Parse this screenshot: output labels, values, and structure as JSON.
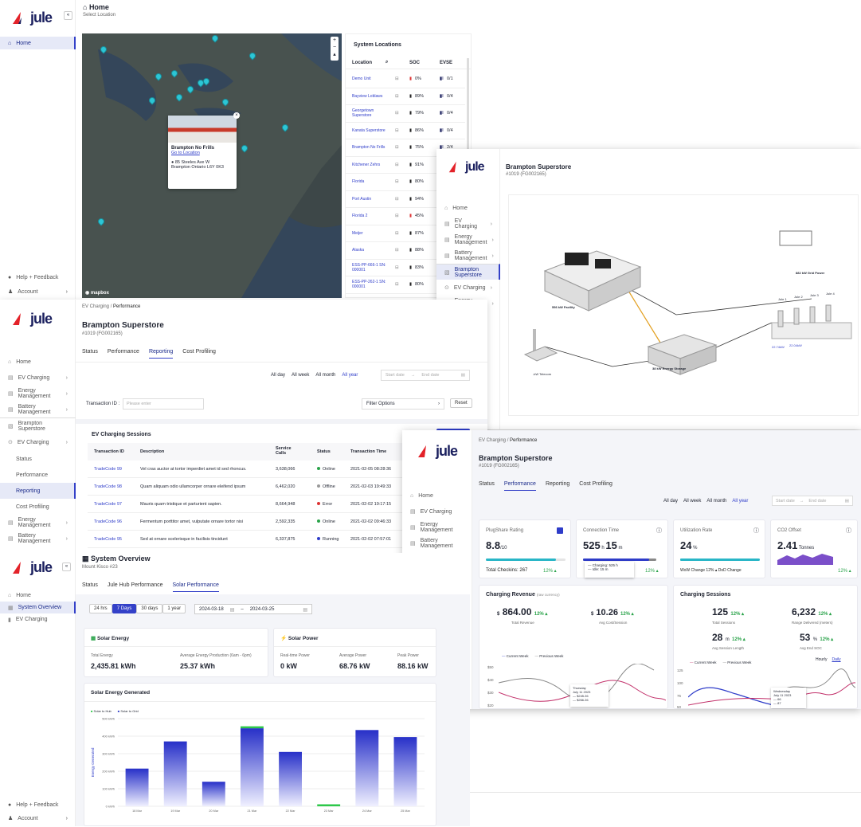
{
  "main": {
    "title": "Home",
    "subtitle": "Select Location",
    "nav": [
      {
        "label": "Home"
      }
    ],
    "footer": {
      "help": "Help + Feedback",
      "account": "Account"
    },
    "map": {
      "attribution": "mapbox",
      "popup": {
        "name": "Brampton No Frills",
        "link": "Go to Location",
        "address1": "85 Steeles Ave W",
        "address2": "Brampton Ontario L6Y 0K3"
      }
    },
    "locations": {
      "title": "System Locations",
      "columns": [
        "Location",
        "SOC",
        "EVSE"
      ],
      "rows": [
        {
          "name": "Demo Unit",
          "soc": "0%",
          "evse": "0/1"
        },
        {
          "name": "Bayview Loblaws",
          "soc": "89%",
          "evse": "0/4"
        },
        {
          "name": "Georgetown Superstore",
          "soc": "79%",
          "evse": "0/4"
        },
        {
          "name": "Kanata Superstore",
          "soc": "86%",
          "evse": "0/4"
        },
        {
          "name": "Brampton No Frills",
          "soc": "75%",
          "evse": "2/4"
        },
        {
          "name": "Kitchener Zehrs",
          "soc": "91%",
          "evse": ""
        },
        {
          "name": "Florida",
          "soc": "80%",
          "evse": ""
        },
        {
          "name": "Port Austin",
          "soc": "94%",
          "evse": ""
        },
        {
          "name": "Florida 2",
          "soc": "45%",
          "evse": ""
        },
        {
          "name": "Meijer",
          "soc": "87%",
          "evse": ""
        },
        {
          "name": "Alaska",
          "soc": "88%",
          "evse": ""
        },
        {
          "name": "ESS-PP-666-1 SN: 000001",
          "soc": "83%",
          "evse": ""
        },
        {
          "name": "ESS-PP-262-1 SN: 000001",
          "soc": "80%",
          "evse": ""
        }
      ]
    }
  },
  "diagram": {
    "site": "Brampton Superstore",
    "site_id": "#1019 (FG002165)",
    "nav": [
      {
        "label": "Home"
      },
      {
        "label": "EV Charging"
      },
      {
        "label": "Energy Management"
      },
      {
        "label": "Battery Management"
      },
      {
        "label": "Brampton Superstore"
      },
      {
        "label": "EV Charging"
      },
      {
        "label": "Energy Management"
      }
    ],
    "labels": {
      "facility": "556 kW Facility",
      "grid": "882 kW Grid Power",
      "telecom": "-kW Telecom",
      "storage": "38 kW Energy Storage",
      "jules": [
        "Jule 1",
        "Jule 2",
        "Jule 3",
        "Jule 4"
      ],
      "status1": "22.74kW",
      "status2": "22.04kW"
    }
  },
  "reporting": {
    "breadcrumb": [
      "EV Charging",
      "Performance"
    ],
    "site": "Brampton Superstore",
    "site_id": "#1019 (FG002165)",
    "tabs": [
      "Status",
      "Performance",
      "Reporting",
      "Cost Profiling"
    ],
    "ranges": [
      "All day",
      "All week",
      "All month",
      "All year"
    ],
    "start_placeholder": "Start date",
    "end_placeholder": "End date",
    "txn_label": "Transaction ID :",
    "txn_placeholder": "Please enter",
    "filter": "Filter Options",
    "reset": "Reset",
    "table_title": "EV Charging Sessions",
    "columns": [
      "Transaction ID",
      "Description",
      "Service Calls",
      "Status",
      "Transaction Time"
    ],
    "rows": [
      {
        "id": "TradeCode 99",
        "desc": "Vel cras auctor at tortor imperdiet amet id sed rhoncus.",
        "calls": "3,638,066",
        "status": "Online",
        "time": "2021-02-05 08:28:36"
      },
      {
        "id": "TradeCode 98",
        "desc": "Quam aliquam odio ullamcorper ornare eleifend ipsum",
        "calls": "6,462,020",
        "status": "Offline",
        "time": "2021-02-03 19:49:33"
      },
      {
        "id": "TradeCode 97",
        "desc": "Mauris quam tristique et parturient sapien.",
        "calls": "8,664,948",
        "status": "Error",
        "time": "2021-02-02 19:17:15"
      },
      {
        "id": "TradeCode 96",
        "desc": "Fermentum porttitor amet, vulputate ornare tortor nisi",
        "calls": "2,592,335",
        "status": "Online",
        "time": "2021-02-02 09:46:33"
      },
      {
        "id": "TradeCode 95",
        "desc": "Sed at ornare scelerisque in facilisis tincidunt",
        "calls": "6,337,875",
        "status": "Running",
        "time": "2021-02-02 07:57:01"
      }
    ],
    "nav": [
      {
        "label": "Home"
      },
      {
        "label": "EV Charging"
      },
      {
        "label": "Energy Management"
      },
      {
        "label": "Battery Management"
      },
      {
        "label": "Brampton Superstore"
      },
      {
        "label": "EV Charging"
      },
      {
        "label": "Status"
      },
      {
        "label": "Performance"
      },
      {
        "label": "Reporting"
      },
      {
        "label": "Cost Profiling"
      },
      {
        "label": "Energy Management"
      },
      {
        "label": "Battery Management"
      }
    ]
  },
  "performance": {
    "breadcrumb": [
      "EV Charging",
      "Performance"
    ],
    "site": "Brampton Superstore",
    "site_id": "#1019 (FG002165)",
    "tabs": [
      "Status",
      "Performance",
      "Reporting",
      "Cost Profiling"
    ],
    "ranges": [
      "All day",
      "All week",
      "All month",
      "All year"
    ],
    "start_placeholder": "Start date",
    "end_placeholder": "End date",
    "nav": [
      {
        "label": "Home"
      },
      {
        "label": "EV Charging"
      },
      {
        "label": "Energy Management"
      },
      {
        "label": "Battery Management"
      }
    ],
    "kpis": [
      {
        "title": "PlugShare Rating",
        "value": "8.8",
        "unit": "/10",
        "foot": "Total Checkins: 267",
        "change": "12%",
        "fill": 0.88
      },
      {
        "title": "Connection Time",
        "value": "525",
        "unit1": "h",
        "value2": "15",
        "unit2": "m",
        "change": "12%",
        "tip1": "Charging: 525 h",
        "tip2": "Idle: 15 m",
        "fill": 0.9
      },
      {
        "title": "Utilization Rate",
        "value": "24",
        "unit": "%",
        "foot": "WoW Change 12% ▴ DoD Change",
        "fill": 0.24
      },
      {
        "title": "CO2 Offset",
        "value": "2.41",
        "unit": "Tonnes",
        "change": "12%"
      }
    ],
    "revenue": {
      "title": "Charging Revenue",
      "sub": "(raw currency)",
      "total": "864.00",
      "total_label": "Total Revenue",
      "total_change": "12%",
      "avg": "10.26",
      "avg_label": "Avg Cost/Session",
      "avg_change": "12%",
      "legend": [
        "Current Week",
        "Previous Week"
      ],
      "yticks": [
        "$50",
        "$40",
        "$30",
        "$20"
      ],
      "tooltip": {
        "day": "Thursday",
        "date": "July 11 2023",
        "v1": "$245.26",
        "v2": "$266.26"
      }
    },
    "sessions": {
      "title": "Charging Sessions",
      "stats": [
        {
          "value": "125",
          "unit": "",
          "label": "Total Sessions",
          "change": "12%"
        },
        {
          "value": "6,232",
          "unit": "",
          "label": "Range Delivered (meters)",
          "change": "12%"
        },
        {
          "value": "28",
          "unit": "m",
          "label": "Avg Session Length",
          "change": "12%"
        },
        {
          "value": "53",
          "unit": "%",
          "label": "Avg End SOC",
          "change": "12%"
        }
      ],
      "legend": [
        "Current Week",
        "Previous Week"
      ],
      "modes": [
        "Hourly",
        "Daily"
      ],
      "yticks": [
        "125",
        "100",
        "75",
        "50"
      ],
      "tooltip": {
        "day": "Wednesday",
        "date": "July 11 2023",
        "v1": "66",
        "v2": "87"
      }
    }
  },
  "overview": {
    "title": "System Overview",
    "subtitle": "Mount Kisco #23",
    "nav": [
      {
        "label": "Home"
      },
      {
        "label": "System Overview"
      },
      {
        "label": "EV Charging"
      }
    ],
    "footer": {
      "help": "Help + Feedback",
      "account": "Account"
    },
    "tabs": [
      "Status",
      "Jule Hub Performance",
      "Solar Performance"
    ],
    "ranges": [
      "24 hrs",
      "7 Days",
      "30 days",
      "1 year"
    ],
    "date_from": "2024-03-18",
    "date_to": "2024-03-25",
    "energy": {
      "title": "Solar Energy",
      "l1": "Total Energy",
      "v1": "2,435.81 kWh",
      "l2": "Average Energy Production (6am - 6pm)",
      "v2": "25.37 kWh"
    },
    "power": {
      "title": "Solar Power",
      "l1": "Real-time Power",
      "v1": "0 kW",
      "l2": "Average Power",
      "v2": "68.76 kW",
      "l3": "Peak Power",
      "v3": "88.16 kW"
    },
    "chart_data": {
      "type": "bar",
      "title": "Solar Energy Generated",
      "ylabel": "Energy Generated",
      "categories": [
        "18 Mar",
        "19 Mar",
        "20 Mar",
        "21 Mar",
        "22 Mar",
        "23 Mar",
        "24 Mar",
        "25 Mar"
      ],
      "series": [
        {
          "name": "Solar to Hub",
          "values": [
            0,
            0,
            0,
            5,
            0,
            5,
            0,
            0
          ],
          "color": "#2ec84a"
        },
        {
          "name": "Solar to Grid",
          "values": [
            215,
            370,
            140,
            445,
            310,
            0,
            435,
            395
          ],
          "color": "#3441c8"
        }
      ],
      "ylim": [
        0,
        500
      ],
      "yticks": [
        "0 kWh",
        "100 kWh",
        "200 kWh",
        "300 kWh",
        "400 kWh",
        "500 kWh"
      ]
    }
  }
}
